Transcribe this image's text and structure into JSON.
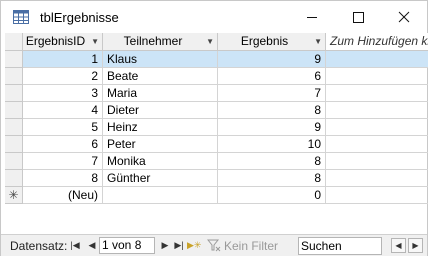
{
  "window": {
    "title": "tblErgebnisse",
    "minimize_icon": "minimize-icon",
    "maximize_icon": "maximize-icon",
    "close_icon": "close-icon"
  },
  "columns": [
    {
      "label": "ErgebnisID",
      "sort_icon": "dropdown-arrow-icon"
    },
    {
      "label": "Teilnehmer",
      "sort_icon": "dropdown-arrow-icon"
    },
    {
      "label": "Ergebnis",
      "sort_icon": "dropdown-arrow-icon"
    },
    {
      "label": "Zum Hinzufügen kli"
    }
  ],
  "rows": [
    {
      "id": "1",
      "name": "Klaus",
      "score": "9"
    },
    {
      "id": "2",
      "name": "Beate",
      "score": "6"
    },
    {
      "id": "3",
      "name": "Maria",
      "score": "7"
    },
    {
      "id": "4",
      "name": "Dieter",
      "score": "8"
    },
    {
      "id": "5",
      "name": "Heinz",
      "score": "9"
    },
    {
      "id": "6",
      "name": "Peter",
      "score": "10"
    },
    {
      "id": "7",
      "name": "Monika",
      "score": "8"
    },
    {
      "id": "8",
      "name": "Günther",
      "score": "8"
    }
  ],
  "new_row": {
    "marker": "✳",
    "id": "(Neu)",
    "name": "",
    "score": "0"
  },
  "navigation": {
    "label": "Datensatz:",
    "position": "1 von 8",
    "filter_label": "Kein Filter",
    "search_label": "Suchen"
  },
  "colors": {
    "selected_row": "#cce4f7",
    "header_bg": "#f0f0f0"
  }
}
